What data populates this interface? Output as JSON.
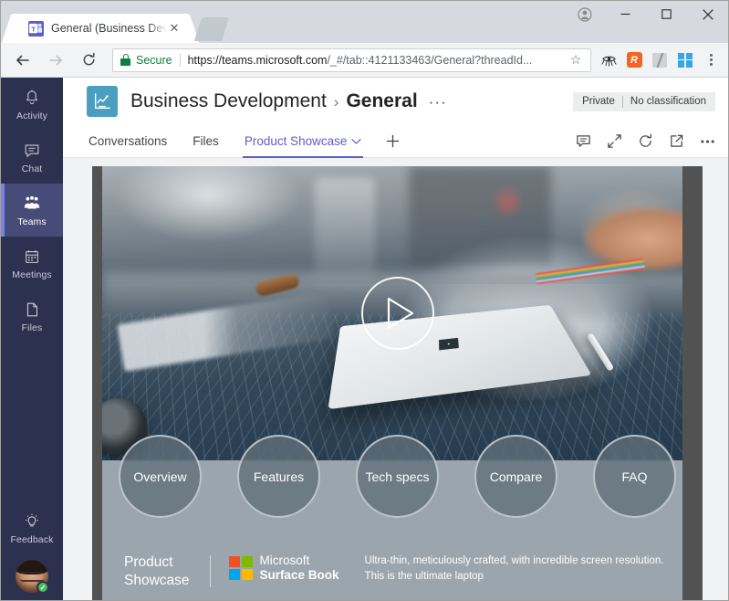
{
  "browser": {
    "tab": {
      "title": "General (Business Develo",
      "favicon_label": "T",
      "favicon_name": "microsoft-teams-favicon",
      "close_label": "✕"
    },
    "new_tab_label": "",
    "window_controls": {
      "profile": "●",
      "minimize": "—",
      "maximize": "☐",
      "close": "✕"
    },
    "toolbar": {
      "back": "←",
      "forward": "→",
      "reload": "⟳",
      "security_label": "Secure",
      "url_prefix": "https://teams.microsoft.com",
      "url_rest": "/_#/tab::4121133463/General?threadId...",
      "star": "☆",
      "extensions": [
        {
          "name": "eye-tracker-icon",
          "glyph": "◉"
        },
        {
          "name": "orange-extension-icon",
          "glyph": "R"
        },
        {
          "name": "gray-extension-icon",
          "glyph": ""
        },
        {
          "name": "windows-extension-icon",
          "glyph": ""
        }
      ],
      "menu": "⋮"
    }
  },
  "rail": {
    "items": [
      {
        "label": "Activity",
        "icon": "bell-icon",
        "active": false
      },
      {
        "label": "Chat",
        "icon": "chat-icon",
        "active": false
      },
      {
        "label": "Teams",
        "icon": "teams-icon",
        "active": true
      },
      {
        "label": "Meetings",
        "icon": "calendar-icon",
        "active": false
      },
      {
        "label": "Files",
        "icon": "file-icon",
        "active": false
      }
    ],
    "feedback": {
      "label": "Feedback",
      "icon": "lightbulb-icon"
    },
    "presence_glyph": "✓"
  },
  "header": {
    "team_name": "Business Development",
    "separator": "›",
    "channel_name": "General",
    "more_label": "···",
    "classification": {
      "privacy": "Private",
      "label": "No classification"
    }
  },
  "tabs": {
    "items": [
      {
        "label": "Conversations",
        "active": false,
        "has_chevron": false
      },
      {
        "label": "Files",
        "active": false,
        "has_chevron": false
      },
      {
        "label": "Product Showcase",
        "active": true,
        "has_chevron": true
      }
    ],
    "add_label": "+",
    "chevron": "⌄",
    "actions": [
      {
        "name": "conversation-icon"
      },
      {
        "name": "expand-icon"
      },
      {
        "name": "refresh-icon"
      },
      {
        "name": "open-in-new-window-icon"
      },
      {
        "name": "more-options-icon"
      }
    ]
  },
  "showcase": {
    "play_button_name": "play-video-button",
    "circles": [
      {
        "label": "Overview"
      },
      {
        "label": "Features"
      },
      {
        "label": "Tech specs"
      },
      {
        "label": "Compare"
      },
      {
        "label": "FAQ"
      }
    ],
    "title": "Product\nShowcase",
    "brand": {
      "company": "Microsoft",
      "product": "Surface Book",
      "logo_colors": [
        "#f25022",
        "#7fba00",
        "#00a4ef",
        "#ffb900"
      ]
    },
    "description": "Ultra-thin, meticulously crafted, with incredible screen resolution.\nThis is the ultimate laptop"
  },
  "colors": {
    "teams_purple": "#5b5fc7",
    "rail_background": "#2d3150",
    "rail_active": "#464b77",
    "secure_green": "#0d7f3f",
    "showcase_gray": "#9aa5ad"
  }
}
